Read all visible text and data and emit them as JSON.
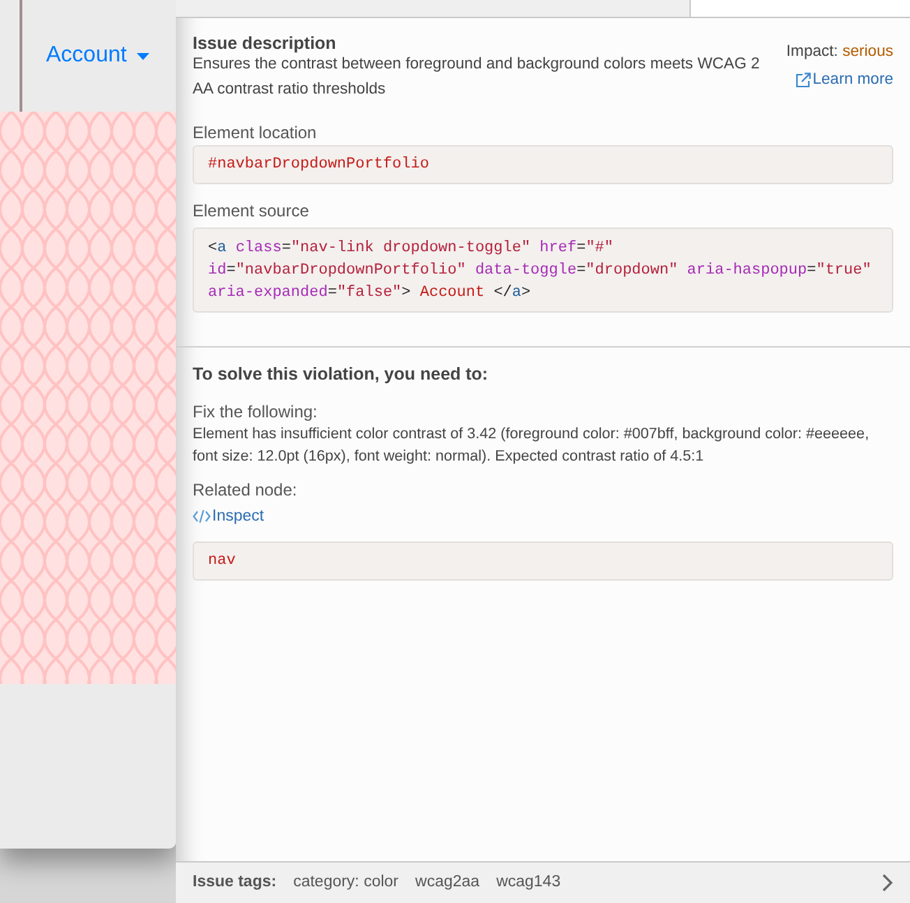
{
  "page": {
    "nav_link": "Account"
  },
  "panel": {
    "issue_description": {
      "heading": "Issue description",
      "text": "Ensures the contrast between foreground and background colors meets WCAG 2 AA contrast ratio thresholds",
      "impact_label": "Impact:",
      "impact": "serious",
      "learn_more": "Learn more"
    },
    "element_location": {
      "label": "Element location",
      "code": "#navbarDropdownPortfolio"
    },
    "element_source": {
      "label": "Element source",
      "tokens": [
        {
          "kind": "punct",
          "text": "<"
        },
        {
          "kind": "tag",
          "text": "a"
        },
        {
          "kind": "attr",
          "text": " class"
        },
        {
          "kind": "punct",
          "text": "="
        },
        {
          "kind": "value",
          "text": "\"nav-link dropdown-toggle\""
        },
        {
          "kind": "attr",
          "text": " href"
        },
        {
          "kind": "punct",
          "text": "="
        },
        {
          "kind": "value",
          "text": "\"#\""
        },
        {
          "kind": "attr",
          "text": " id"
        },
        {
          "kind": "punct",
          "text": "="
        },
        {
          "kind": "value",
          "text": "\"navbarDropdownPortfolio\""
        },
        {
          "kind": "attr",
          "text": " data-toggle"
        },
        {
          "kind": "punct",
          "text": "="
        },
        {
          "kind": "value",
          "text": "\"dropdown\""
        },
        {
          "kind": "attr",
          "text": " aria-haspopup"
        },
        {
          "kind": "punct",
          "text": "="
        },
        {
          "kind": "value",
          "text": "\"true\""
        },
        {
          "kind": "attr",
          "text": " aria-expanded"
        },
        {
          "kind": "punct",
          "text": "="
        },
        {
          "kind": "value",
          "text": "\"false\""
        },
        {
          "kind": "punct",
          "text": ">"
        },
        {
          "kind": "text",
          "text": " Account "
        },
        {
          "kind": "punct",
          "text": "</"
        },
        {
          "kind": "tag",
          "text": "a"
        },
        {
          "kind": "punct",
          "text": ">"
        }
      ]
    },
    "solution": {
      "heading": "To solve this violation, you need to:",
      "fix_label": "Fix the following:",
      "fix_text": "Element has insufficient color contrast of 3.42 (foreground color: #007bff, background color: #eeeeee, font size: 12.0pt (16px), font weight: normal). Expected contrast ratio of 4.5:1",
      "related_label": "Related node:",
      "inspect": "Inspect",
      "related_code": "nav"
    },
    "footer": {
      "label": "Issue tags:",
      "tags": [
        "category: color",
        "wcag2aa",
        "wcag143"
      ]
    }
  }
}
